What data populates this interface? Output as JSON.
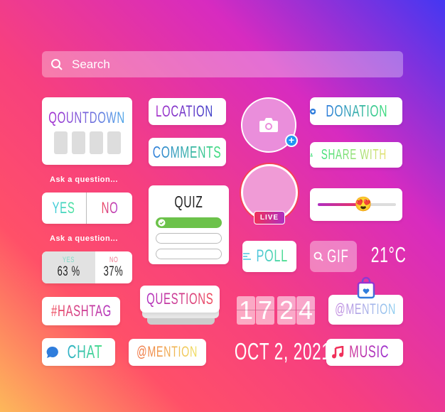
{
  "search": {
    "placeholder": "Search",
    "icon": "search-icon"
  },
  "countdown": {
    "title": "QOUNTDOWN"
  },
  "ask1": {
    "label": "Ask a question...",
    "yes": "YES",
    "no": "NO"
  },
  "ask2": {
    "label": "Ask a question...",
    "yes": "YES",
    "no": "NO",
    "yes_pct": "63 %",
    "no_pct": "37%",
    "yes_fraction": 0.63
  },
  "location": {
    "label": "LOCATION",
    "icon": "map-pin-icon"
  },
  "comments": {
    "label": "COMMENTS"
  },
  "quiz": {
    "title": "QUIZ",
    "options_count_checked": 1
  },
  "camera": {
    "icon": "camera-icon",
    "add_icon": "plus-icon"
  },
  "live": {
    "badge": "LIVE"
  },
  "poll": {
    "label": "POLL",
    "icon": "list-icon"
  },
  "gif": {
    "label": "GIF",
    "icon": "search-icon"
  },
  "temperature": {
    "value": "21°C"
  },
  "donation": {
    "label": "DONATION",
    "icon": "heart-icon"
  },
  "share": {
    "label": "SHARE WITH",
    "icon": "person-icon"
  },
  "slider": {
    "value": 0.58,
    "emoji": "😍"
  },
  "hashtag": {
    "label": "#HASHTAG"
  },
  "questions": {
    "label": "QUESTIONS"
  },
  "timer": {
    "digits": [
      "1",
      "7",
      "2",
      "4"
    ]
  },
  "mention_shop": {
    "label": "@MENTION",
    "icon": "shopping-bag-icon"
  },
  "chat": {
    "label": "CHAT",
    "icon": "chat-bubble-icon"
  },
  "mention": {
    "label": "@MENTION"
  },
  "date": {
    "value": "OCT 2, 2021"
  },
  "music": {
    "label": "MUSIC",
    "icon": "music-note-icon"
  }
}
